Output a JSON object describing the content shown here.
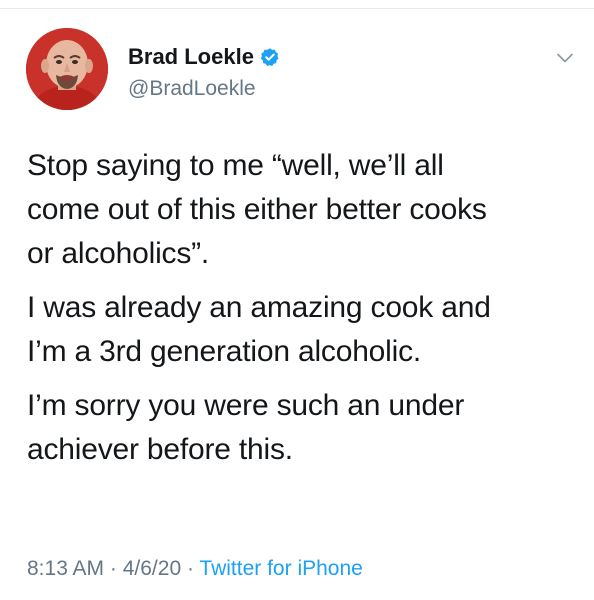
{
  "tweet": {
    "author": {
      "display_name": "Brad Loekle",
      "handle": "@BradLoekle",
      "verified": true,
      "avatar_icon": "profile-photo"
    },
    "text": {
      "line_1": "Stop saying to me “well, we’ll all",
      "line_2": "come out of this either better cooks",
      "line_3": "or alcoholics”.",
      "line_4": "I was already an amazing cook and",
      "line_5": "I’m a 3rd generation alcoholic.",
      "line_6": "I’m sorry you were such an under",
      "line_7": "achiever before this."
    },
    "meta": {
      "time": "8:13 AM",
      "separator_1": " · ",
      "date": "4/6/20",
      "separator_2": " · ",
      "source": "Twitter for iPhone"
    },
    "menu_icon": "chevron-down-icon"
  },
  "colors": {
    "text": "#14171a",
    "secondary": "#657786",
    "accent": "#1da1f2",
    "avatar_bg": "#c8322a"
  }
}
